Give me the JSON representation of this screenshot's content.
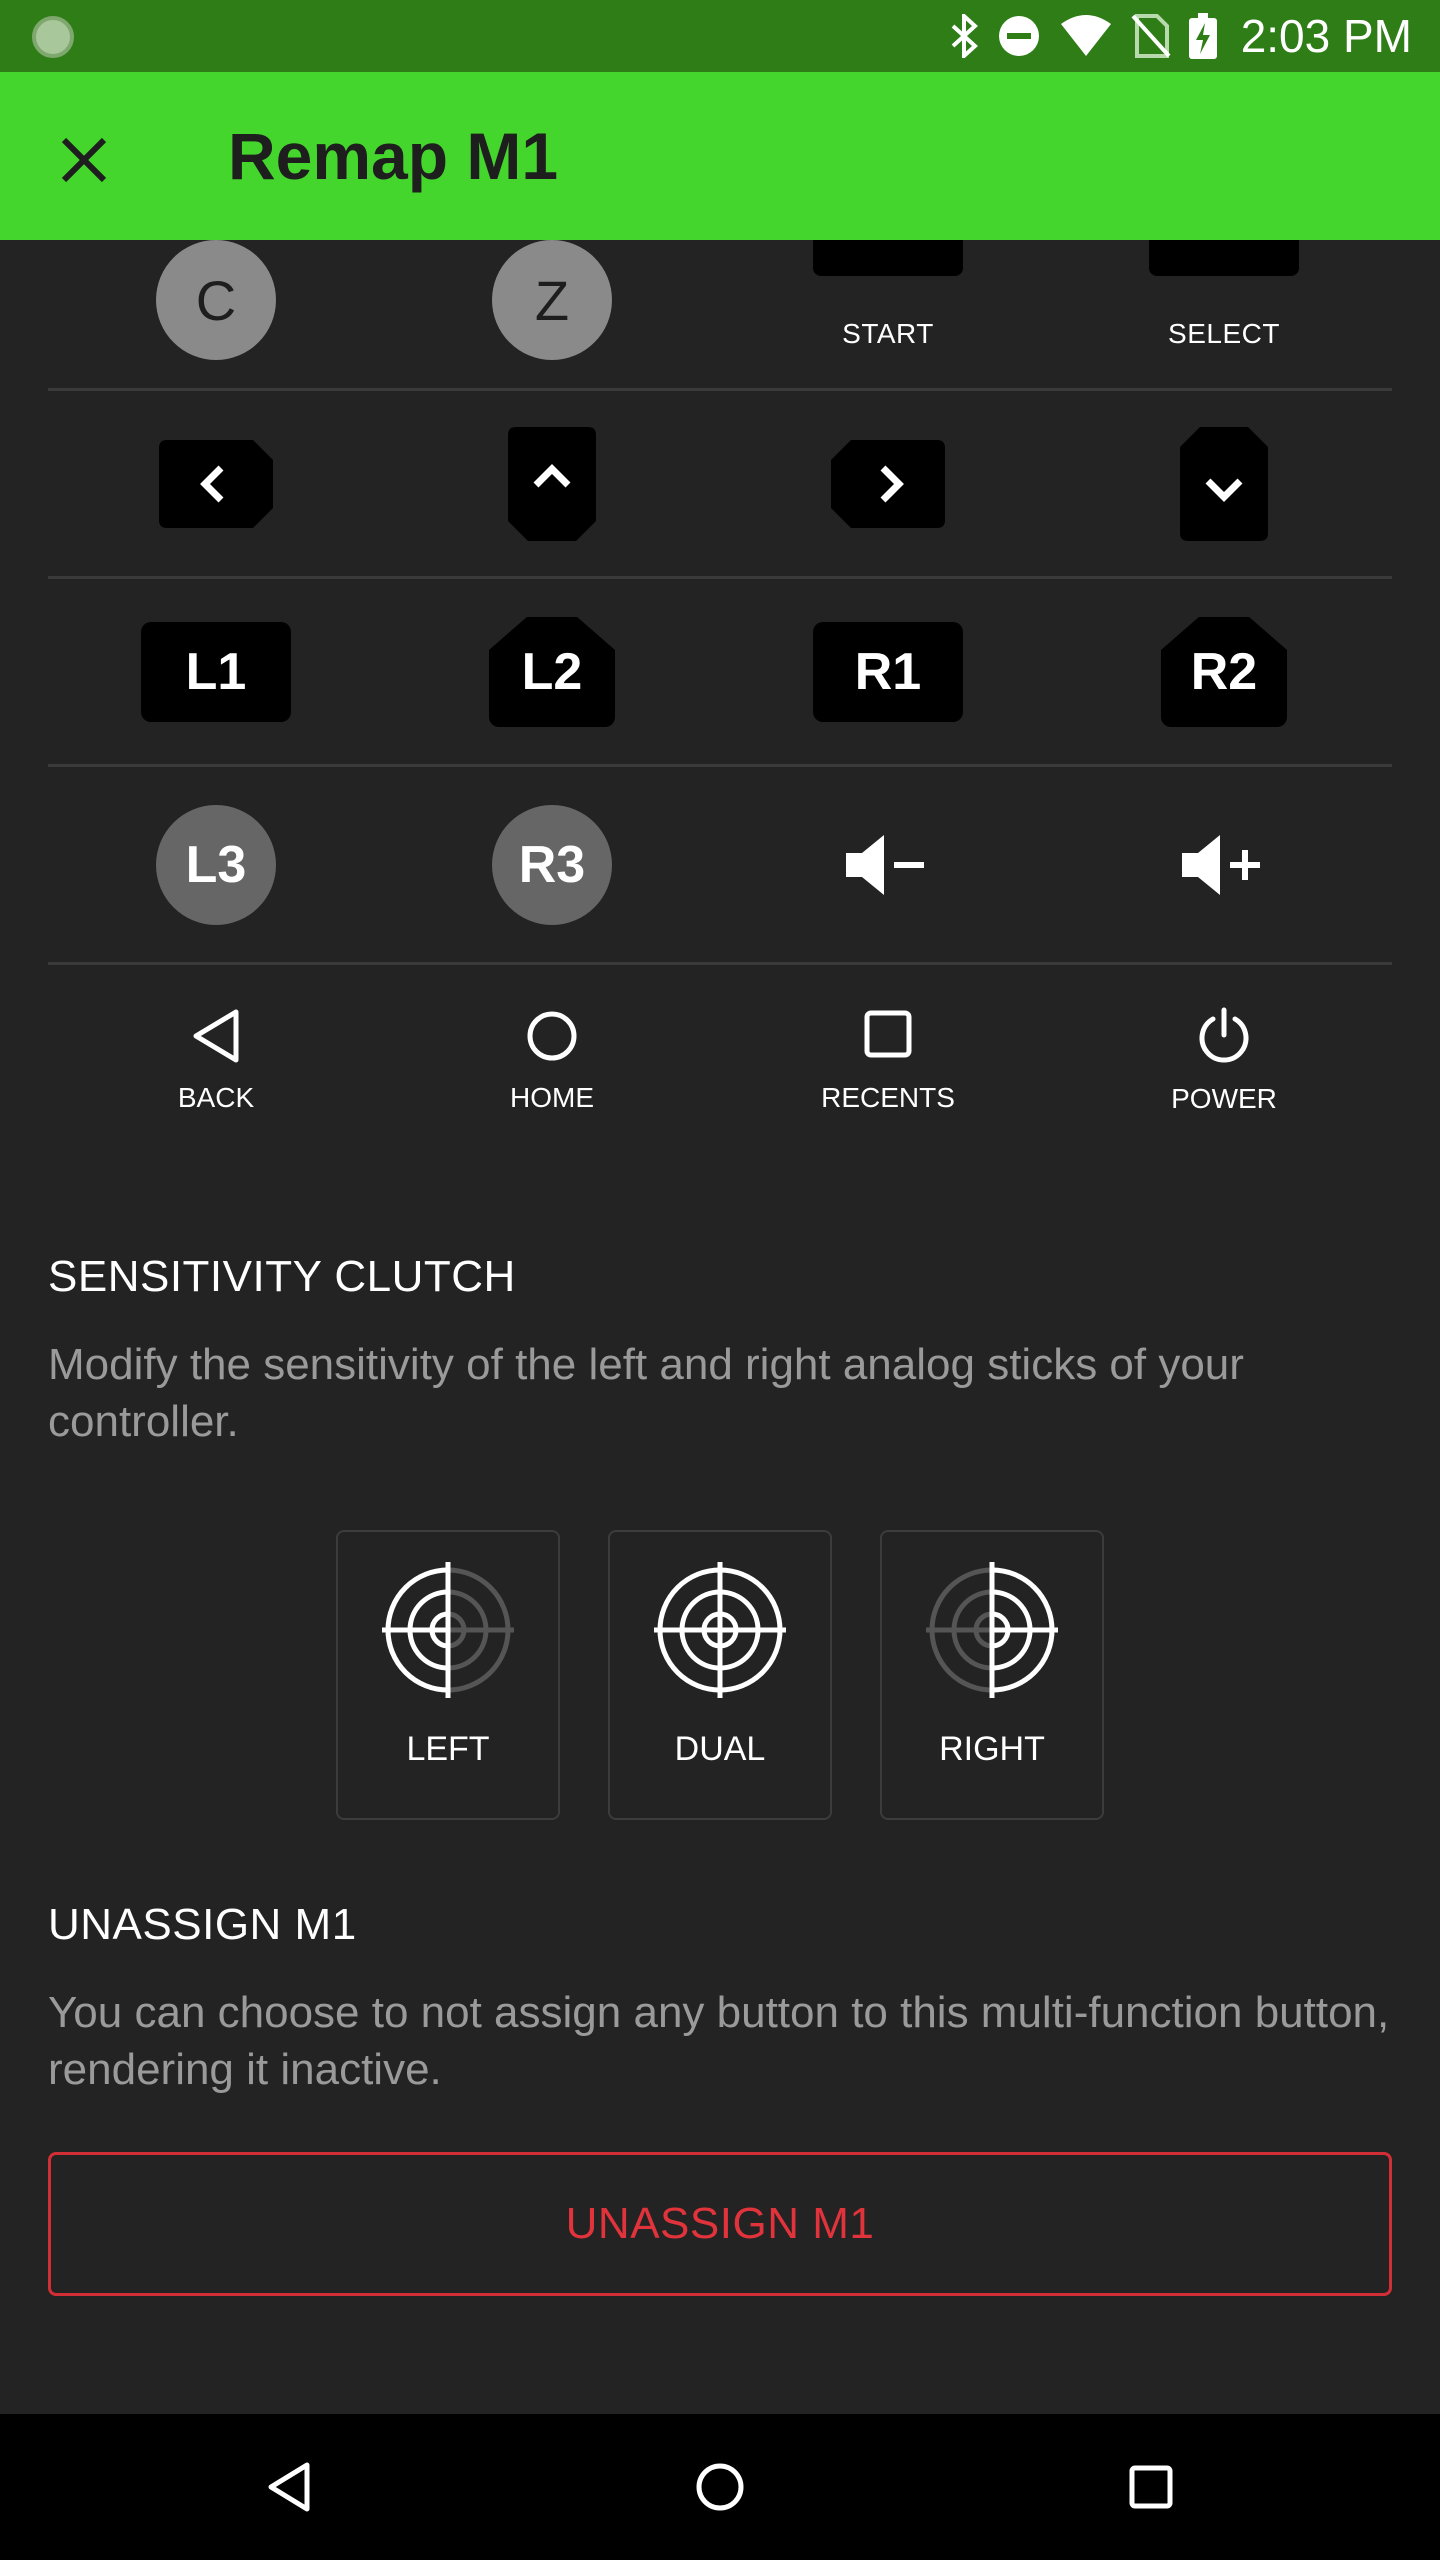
{
  "status_bar": {
    "time": "2:03 PM",
    "icons": [
      "app-icon",
      "bluetooth-icon",
      "do-not-disturb-icon",
      "wifi-icon",
      "no-sim-icon",
      "battery-charging-icon"
    ]
  },
  "app_bar": {
    "title": "Remap M1",
    "close_icon": "close-icon",
    "accent_color": "#44d62c"
  },
  "rows": {
    "row1": [
      {
        "label": "C",
        "type": "circle"
      },
      {
        "label": "Z",
        "type": "circle"
      },
      {
        "label": "START",
        "type": "rect"
      },
      {
        "label": "SELECT",
        "type": "rect"
      }
    ],
    "dpad": [
      "dpad-left-icon",
      "dpad-up-icon",
      "dpad-right-icon",
      "dpad-down-icon"
    ],
    "shoulders": [
      {
        "label": "L1"
      },
      {
        "label": "L2"
      },
      {
        "label": "R1"
      },
      {
        "label": "R2"
      }
    ],
    "row4": [
      {
        "label": "L3"
      },
      {
        "label": "R3"
      },
      {
        "icon": "volume-down-icon"
      },
      {
        "icon": "volume-up-icon"
      }
    ],
    "system": [
      {
        "label": "BACK",
        "icon": "back-triangle-icon"
      },
      {
        "label": "HOME",
        "icon": "home-circle-icon"
      },
      {
        "label": "RECENTS",
        "icon": "recents-square-icon"
      },
      {
        "label": "POWER",
        "icon": "power-icon"
      }
    ]
  },
  "sensitivity": {
    "title": "SENSITIVITY CLUTCH",
    "description": "Modify the sensitivity of the left and right analog sticks of your controller.",
    "options": [
      {
        "label": "LEFT",
        "icon": "crosshair-left-icon"
      },
      {
        "label": "DUAL",
        "icon": "crosshair-dual-icon"
      },
      {
        "label": "RIGHT",
        "icon": "crosshair-right-icon"
      }
    ]
  },
  "unassign": {
    "title": "UNASSIGN M1",
    "description": "You can choose to not assign any button to this multi-function button, rendering it inactive.",
    "button_label": "UNASSIGN M1",
    "button_color": "#e1333b"
  },
  "nav_bar": {
    "icons": [
      "nav-back-icon",
      "nav-home-icon",
      "nav-recents-icon"
    ]
  }
}
